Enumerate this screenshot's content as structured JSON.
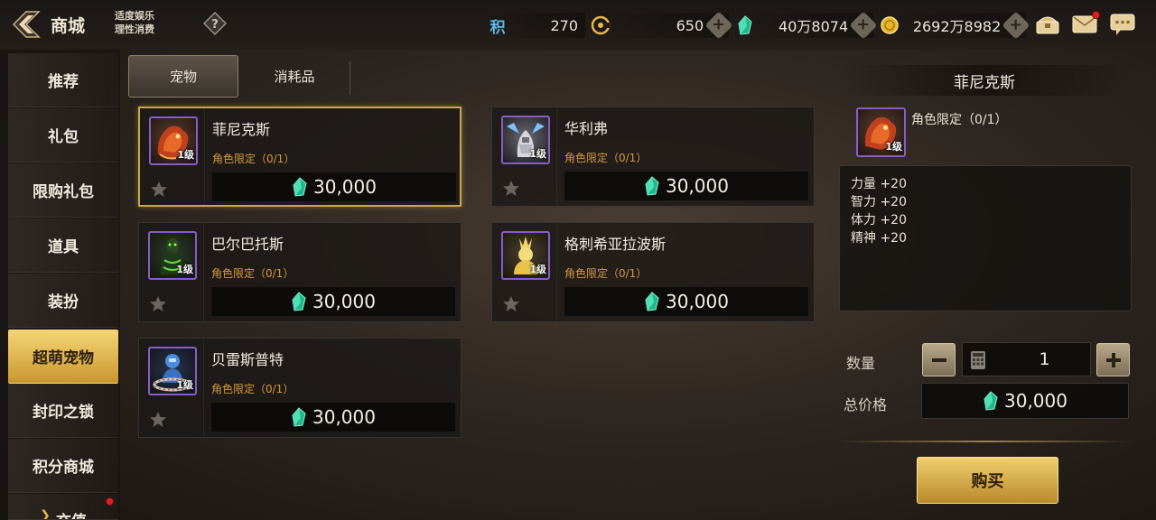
{
  "header": {
    "title": "商城",
    "notice_line1": "适度娱乐",
    "notice_line2": "理性消费",
    "currencies": [
      {
        "icon": "points-icon",
        "glyph": "积",
        "value": "270"
      },
      {
        "icon": "gold-c-coin-icon",
        "value": "650"
      },
      {
        "icon": "green-crystal-icon",
        "value": "40万8074"
      },
      {
        "icon": "gold-coin-icon",
        "value": "2692万8982"
      }
    ]
  },
  "sidebar": {
    "items": [
      {
        "label": "推荐"
      },
      {
        "label": "礼包"
      },
      {
        "label": "限购礼包"
      },
      {
        "label": "道具"
      },
      {
        "label": "装扮"
      },
      {
        "label": "超萌宠物",
        "active": true
      },
      {
        "label": "封印之锁"
      },
      {
        "label": "积分商城"
      },
      {
        "label": "充值"
      }
    ]
  },
  "tabs": [
    {
      "label": "宠物",
      "active": true
    },
    {
      "label": "消耗品"
    }
  ],
  "products": [
    {
      "name": "菲尼克斯",
      "level": "1级",
      "limit": "角色限定（0/1）",
      "price": "30,000",
      "selected": true,
      "pet": "phoenix"
    },
    {
      "name": "华利弗",
      "level": "1级",
      "limit": "角色限定（0/1）",
      "price": "30,000",
      "pet": "knight"
    },
    {
      "name": "巴尔巴托斯",
      "level": "1级",
      "limit": "角色限定（0/1）",
      "price": "30,000",
      "pet": "demon"
    },
    {
      "name": "格刺希亚拉波斯",
      "level": "1级",
      "limit": "角色限定（0/1）",
      "price": "30,000",
      "pet": "golden"
    },
    {
      "name": "贝雷斯普特",
      "level": "1级",
      "limit": "角色限定（0/1）",
      "price": "30,000",
      "pet": "robot"
    }
  ],
  "detail": {
    "title": "菲尼克斯",
    "level": "1级",
    "limit": "角色限定（0/1）",
    "stats": [
      "力量 +20",
      "智力 +20",
      "体力 +20",
      "精神 +20"
    ],
    "quantity_label": "数量",
    "quantity": "1",
    "total_label": "总价格",
    "total": "30,000",
    "buy_label": "购买"
  },
  "colors": {
    "accent_gold": "#c9a74c",
    "limit_orange": "#d49a3a",
    "crystal_green": "#2fd0a0"
  }
}
